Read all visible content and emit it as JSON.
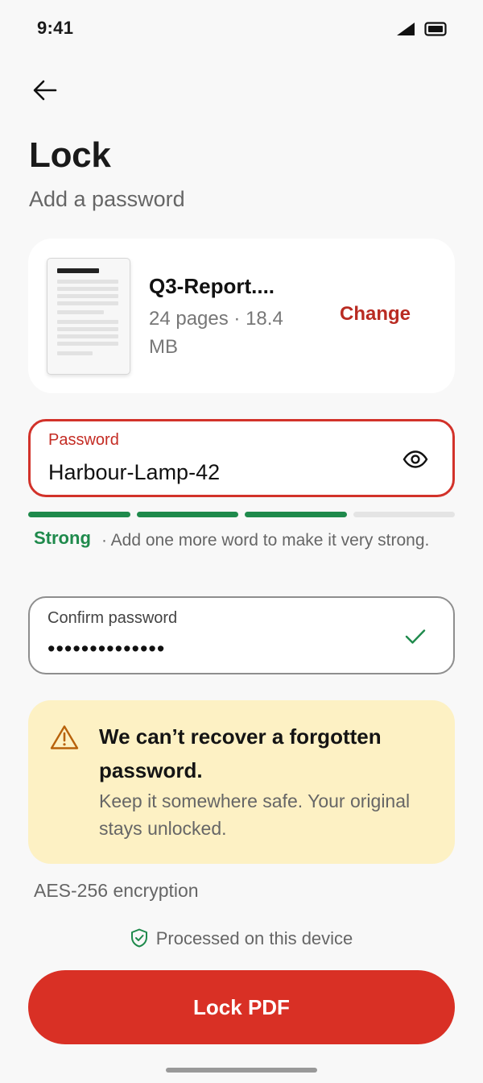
{
  "status_bar": {
    "time": "9:41",
    "icons": [
      "signal-icon",
      "battery-icon"
    ]
  },
  "header": {
    "back_icon": "arrow-left-icon",
    "title": "Lock",
    "subtitle": "Add a password"
  },
  "file": {
    "name": "Q3-Report....",
    "meta": "24 pages · 18.4 MB",
    "change_label": "Change",
    "thumbnail_icon": "document-thumbnail"
  },
  "password": {
    "label": "Password",
    "value": "Harbour-Lamp-42",
    "toggle_icon": "eye-icon"
  },
  "strength": {
    "segments_filled": 3,
    "segments_total": 4,
    "label": "Strong",
    "hint": "· Add one more word to make it very strong.",
    "filled_color": "#1f8a4c",
    "empty_color": "#e4e4e4"
  },
  "confirm": {
    "label": "Confirm password",
    "value": "••••••••••••••",
    "status_icon": "check-icon"
  },
  "warning": {
    "icon": "warning-triangle-icon",
    "title": "We can’t recover a forgotten password.",
    "body": "Keep it somewhere safe. Your original stays unlocked."
  },
  "encryption": "AES-256 encryption",
  "device_note": {
    "icon": "shield-check-icon",
    "text": "Processed on this device"
  },
  "primary_button": {
    "label": "Lock PDF"
  },
  "colors": {
    "accent": "#d93025",
    "field_error": "#d2322a",
    "success": "#1f8a4c",
    "warning_bg": "#fdf1c4",
    "warning_icon": "#b8620b"
  }
}
